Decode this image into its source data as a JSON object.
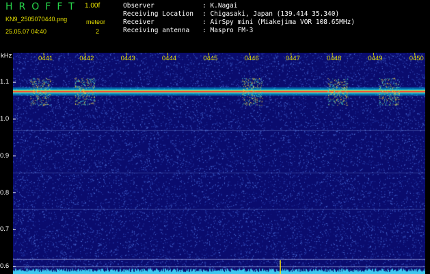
{
  "header": {
    "app_name": "HROFFT",
    "version": "1.00f",
    "filename": "KN9_2505070440.png",
    "datetime": "25.05.07 04:40",
    "meteor_label": "meteor",
    "meteor_count": "2",
    "info": [
      {
        "label": "Observer",
        "value": ": K.Nagai"
      },
      {
        "label": "Receiving Location",
        "value": ": Chigasaki, Japan (139.414 35.340)"
      },
      {
        "label": "Receiver",
        "value": ": AirSpy mini (Miakejima VOR 108.65MHz)"
      },
      {
        "label": "Receiving antenna",
        "value": ": Maspro FM-3"
      }
    ]
  },
  "colors": {
    "background": "#0a0c6e",
    "noise": "#2a3ea8",
    "tick_text": "#e5e000",
    "app_name": "#27d64a",
    "carrier": "#ff3030"
  },
  "chart_data": {
    "type": "heatmap",
    "ylabel": "kHz",
    "y_ticks": [
      "1.1",
      "1.0",
      "0.9",
      "0.8",
      "0.7",
      "0.6"
    ],
    "ylim": [
      0.58,
      1.18
    ],
    "x_ticks": [
      "0441",
      "0442",
      "0443",
      "0444",
      "0445",
      "0446",
      "0447",
      "0448",
      "0449",
      "0450"
    ],
    "carrier_khz": 1.075,
    "meteor_count": 2,
    "grid": false
  }
}
